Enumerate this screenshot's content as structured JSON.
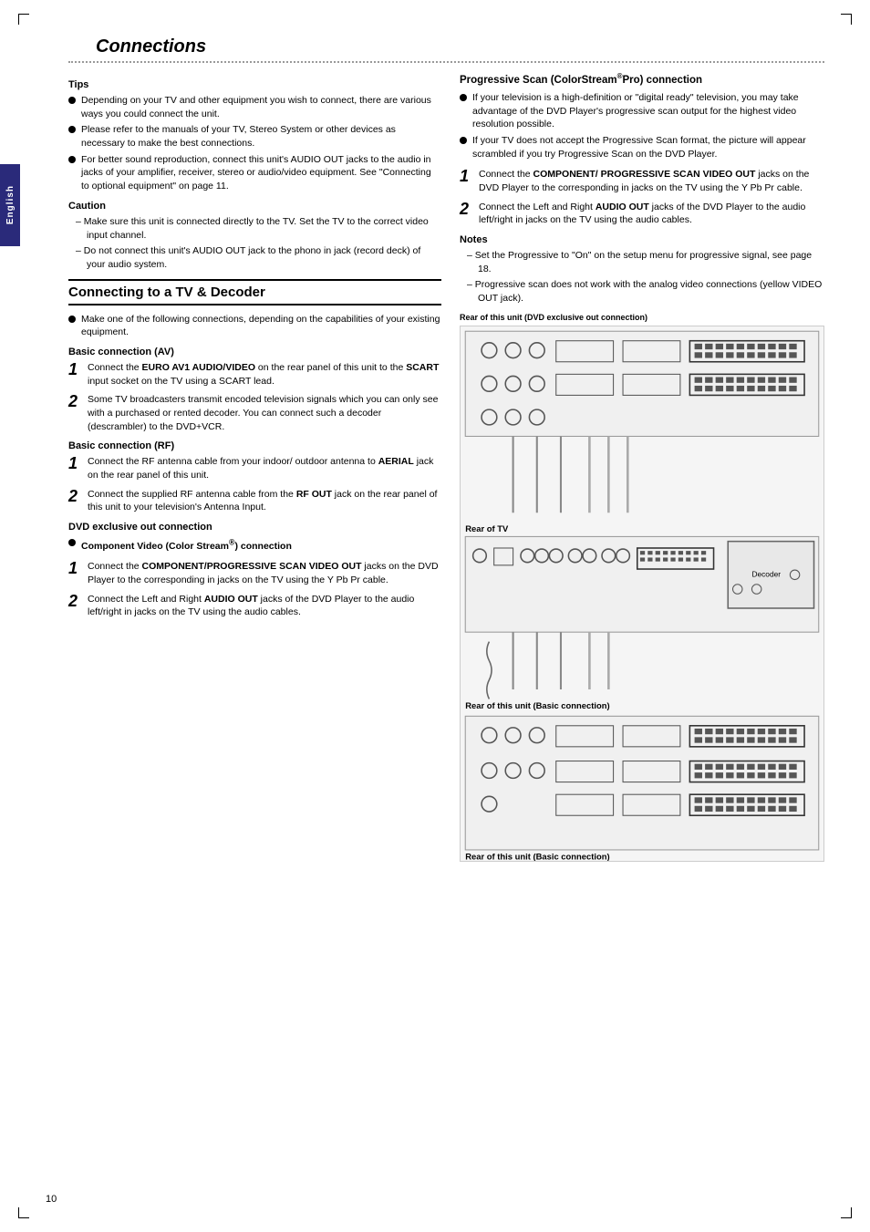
{
  "page": {
    "title": "Connections",
    "number": "10",
    "side_tab": "English"
  },
  "tips": {
    "header": "Tips",
    "items": [
      "Depending on your TV and other equipment you wish to connect, there are various ways you could connect the unit.",
      "Please refer to the manuals of your TV, Stereo System or other devices as necessary to make the best connections.",
      "For better sound reproduction, connect this unit's AUDIO OUT jacks to the audio in jacks of your amplifier, receiver, stereo or audio/video equipment. See \"Connecting to optional equipment\" on page 11."
    ]
  },
  "caution": {
    "header": "Caution",
    "items": [
      "Make sure this unit is connected directly to the TV. Set the TV to the correct video input channel.",
      "Do not connect this unit's AUDIO OUT jack to the phono in jack (record deck) of your audio system."
    ]
  },
  "connecting_section": {
    "header": "Connecting to a TV & Decoder",
    "intro": "Make one of the following connections, depending on the capabilities of your existing equipment.",
    "basic_av": {
      "header": "Basic connection (AV)",
      "step1": {
        "num": "1",
        "text_normal": "Connect the ",
        "text_bold": "EURO AV1 AUDIO/VIDEO",
        "text_after": " on the rear panel of this unit to the ",
        "text_bold2": "SCART",
        "text_after2": " input socket on the TV using a SCART lead."
      },
      "step2": {
        "num": "2",
        "text": "Some TV broadcasters transmit encoded television signals which you can only see with a purchased or rented decoder. You can connect such a decoder (descrambler) to the DVD+VCR."
      }
    },
    "basic_rf": {
      "header": "Basic connection (RF)",
      "step1": {
        "num": "1",
        "text_normal": "Connect the RF antenna cable from your indoor/ outdoor antenna to ",
        "text_bold": "AERIAL",
        "text_after": " jack on the rear panel of this unit."
      },
      "step2": {
        "num": "2",
        "text_normal": "Connect the supplied RF antenna cable from the ",
        "text_bold": "RF OUT",
        "text_after": " jack on the rear panel of this unit to your television's Antenna Input."
      }
    },
    "dvd_exclusive": {
      "header": "DVD exclusive out connection",
      "component_header": "Component Video (Color Stream",
      "component_sup": "®",
      "component_header2": ") connection",
      "step1": {
        "num": "1",
        "text_normal": "Connect the ",
        "text_bold": "COMPONENT/PROGRESSIVE SCAN VIDEO OUT",
        "text_after": " jacks on the DVD Player to the corresponding in jacks on the TV using the Y Pb Pr cable."
      },
      "step2": {
        "num": "2",
        "text_normal": "Connect the Left and Right ",
        "text_bold": "AUDIO OUT",
        "text_after": " jacks of the DVD Player to the audio left/right in jacks on the TV using the audio cables."
      }
    }
  },
  "progressive_scan": {
    "header": "Progressive Scan (ColorStream",
    "header_sup": "®",
    "header2": "Pro) connection",
    "items": [
      "If your television is a high-definition or \"digital ready\" television, you may take advantage of the DVD Player's progressive scan output for the highest video resolution possible.",
      "If your TV does not accept the Progressive Scan format, the picture will appear scrambled if you try Progressive Scan on the DVD Player."
    ],
    "step1": {
      "num": "1",
      "text_normal": "Connect the ",
      "text_bold": "COMPONENT/ PROGRESSIVE SCAN VIDEO OUT",
      "text_after": " jacks on the DVD Player to the corresponding in jacks on the TV using the Y Pb Pr cable."
    },
    "step2": {
      "num": "2",
      "text_normal": "Connect the Left and Right ",
      "text_bold": "AUDIO OUT",
      "text_after": " jacks of the DVD Player to the audio left/right in jacks on the TV using the audio cables."
    },
    "notes_header": "Notes",
    "notes": [
      "Set the Progressive to \"On\" on the setup menu for progressive signal, see page 18.",
      "Progressive scan does not work with the analog video connections (yellow VIDEO OUT jack)."
    ],
    "diagram_top_label": "Rear of this unit (DVD exclusive out connection)",
    "diagram_bottom_label": "Rear of TV",
    "diagram_bottom2_label": "Rear of this unit (Basic connection)"
  }
}
